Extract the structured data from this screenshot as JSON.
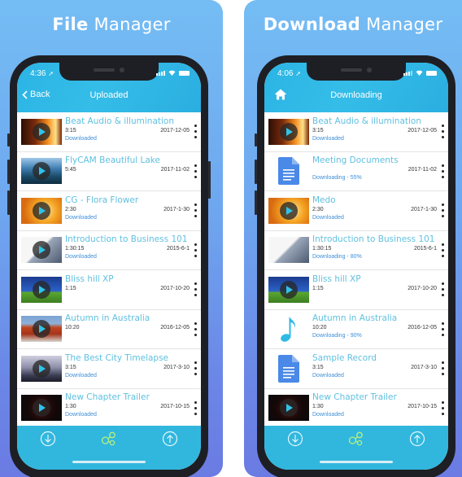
{
  "panels": [
    {
      "headline_bold": "File",
      "headline_light": "Manager",
      "phone": {
        "time": "4:36",
        "nav_left": "Back",
        "nav_title": "Uploaded",
        "items": [
          {
            "title": "Beat Audio & illumination",
            "duration": "3:15",
            "date": "2017-12-05",
            "status": "Downloaded",
            "thumb": "beat",
            "icon": "video-thumbnail"
          },
          {
            "title": "FlyCAM Beautiful Lake",
            "duration": "5:45",
            "date": "2017-11-02",
            "status": "",
            "thumb": "lake",
            "icon": "video-thumbnail"
          },
          {
            "title": "CG - Flora Flower",
            "duration": "2:30",
            "date": "2017-1-30",
            "status": "Downloaded",
            "thumb": "flora",
            "icon": "video-thumbnail"
          },
          {
            "title": "Introduction to Business 101",
            "duration": "1:30:15",
            "date": "2015-6-1",
            "status": "Downloaded",
            "thumb": "intro",
            "icon": "video-thumbnail"
          },
          {
            "title": "Bliss hill XP",
            "duration": "1:15",
            "date": "2017-10-20",
            "status": "",
            "thumb": "bliss",
            "icon": "video-thumbnail"
          },
          {
            "title": "Autumn in Australia",
            "duration": "10:20",
            "date": "2016-12-05",
            "status": "",
            "thumb": "autumn",
            "icon": "video-thumbnail"
          },
          {
            "title": "The Best City Timelapse",
            "duration": "3:15",
            "date": "2017-3-10",
            "status": "Downloaded",
            "thumb": "city",
            "icon": "video-thumbnail"
          },
          {
            "title": "New Chapter Trailer",
            "duration": "1:30",
            "date": "2017-10-15",
            "status": "Downloaded",
            "thumb": "chapter",
            "icon": "video-thumbnail"
          }
        ]
      }
    },
    {
      "headline_bold": "Download",
      "headline_light": "Manager",
      "phone": {
        "time": "4:06",
        "nav_left": "",
        "nav_title": "Downloading",
        "items": [
          {
            "title": "Beat Audio & illumination",
            "duration": "3:15",
            "date": "2017-12-05",
            "status": "Downloaded",
            "thumb": "beat",
            "icon": "video-thumbnail"
          },
          {
            "title": "Meeting Documents",
            "duration": "",
            "date": "2017-11-02",
            "status": "Downloading - 55%",
            "thumb": "doc",
            "icon": "document-icon"
          },
          {
            "title": "Medo",
            "duration": "2:30",
            "date": "2017-1-30",
            "status": "Downloaded",
            "thumb": "flora",
            "icon": "video-thumbnail"
          },
          {
            "title": "Introduction to Business 101",
            "duration": "1:30:15",
            "date": "2015-6-1",
            "status": "Downloading - 80%",
            "thumb": "intro-noplay",
            "icon": "video-thumbnail"
          },
          {
            "title": "Bliss hill XP",
            "duration": "1:15",
            "date": "2017-10-20",
            "status": "",
            "thumb": "bliss",
            "icon": "video-thumbnail"
          },
          {
            "title": "Autumn in Australia",
            "duration": "10:20",
            "date": "2016-12-05",
            "status": "Downloading - 90%",
            "thumb": "music",
            "icon": "music-note-icon"
          },
          {
            "title": "Sample Record",
            "duration": "3:15",
            "date": "2017-3-10",
            "status": "Downloaded",
            "thumb": "doc",
            "icon": "document-icon"
          },
          {
            "title": "New Chapter Trailer",
            "duration": "1:30",
            "date": "2017-10-15",
            "status": "Downloaded",
            "thumb": "chapter",
            "icon": "video-thumbnail"
          }
        ]
      }
    }
  ],
  "tabbar": {
    "items": [
      {
        "name": "download-tab",
        "icon": "download-circle-icon"
      },
      {
        "name": "share-tab",
        "icon": "share-nodes-icon"
      },
      {
        "name": "upload-tab",
        "icon": "upload-circle-icon"
      }
    ]
  },
  "colors": {
    "accent": "#31b7de",
    "title_text": "#5fc0e0",
    "status_text": "#3f8fd8",
    "active_tab_icon": "#b6f07c",
    "background_top": "#74bdf4",
    "background_bottom": "#6b7be3"
  }
}
